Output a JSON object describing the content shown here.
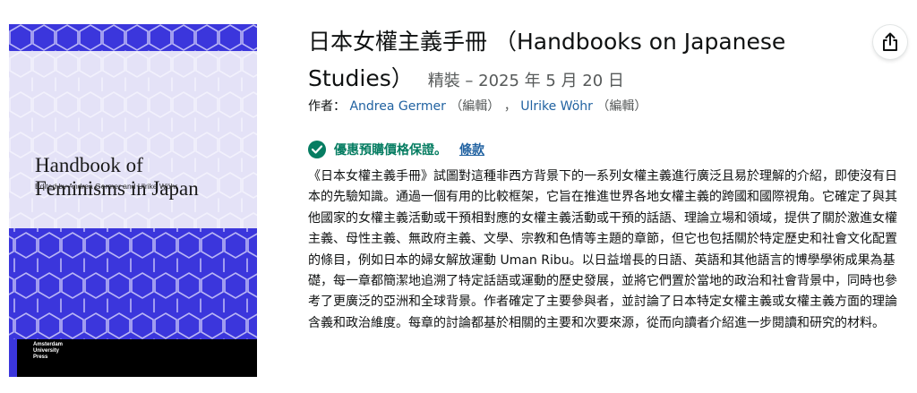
{
  "book_cover": {
    "title_line1": "Handbook of",
    "title_line2": "Feminisms in Japan",
    "editors": "Edited by Andrea Germer and Ulrike Wöhr",
    "publisher": "Amsterdam\nUniversity\nPress",
    "colors": {
      "primary": "#3b36dc",
      "panel": "#e4e2f7"
    }
  },
  "product": {
    "title_line1": "日本女權主義手冊 （Handbooks on Japanese",
    "title_line2": "Studies）",
    "format": "精裝 – 2025 年 5 月 20 日",
    "byline_prefix": "作者：",
    "authors": [
      {
        "name": "Andrea Germer",
        "role": "（編輯）"
      },
      {
        "name": "Ulrike Wöhr",
        "role": "（編輯）"
      }
    ],
    "author_separator": "，"
  },
  "guarantee": {
    "label": "優惠預購價格保證。",
    "terms_link": "條款",
    "icon": "check-circle-icon",
    "color": "#067d62"
  },
  "description": "《日本女權主義手冊》試圖對這種非西方背景下的一系列女權主義進行廣泛且易於理解的介紹，即使沒有日本的先驗知識。通過一個有用的比較框架，它旨在推進世界各地女權主義的跨國和國際視角。它確定了與其他國家的女權主義活動或干預相對應的女權主義活動或干預的話語、理論立場和領域，提供了關於激進女權主義、母性主義、無政府主義、文學、宗教和色情等主題的章節，但它也包括關於特定歷史和社會文化配置的條目，例如日本的婦女解放運動 Uman Ribu。以日益增長的日語、英語和其他語言的博學學術成果為基礎，每一章都簡潔地追溯了特定話語或運動的歷史發展，並將它們置於當地的政治和社會背景中，同時也參考了更廣泛的亞洲和全球背景。作者確定了主要參與者，並討論了日本特定女權主義或女權主義方面的理論含義和政治維度。每章的討論都基於相關的主要和次要來源，從而向讀者介紹進一步閱讀和研究的材料。",
  "share": {
    "icon": "share-icon"
  },
  "colors": {
    "link": "#2162a1",
    "text": "#0f1111",
    "muted": "#565959"
  }
}
